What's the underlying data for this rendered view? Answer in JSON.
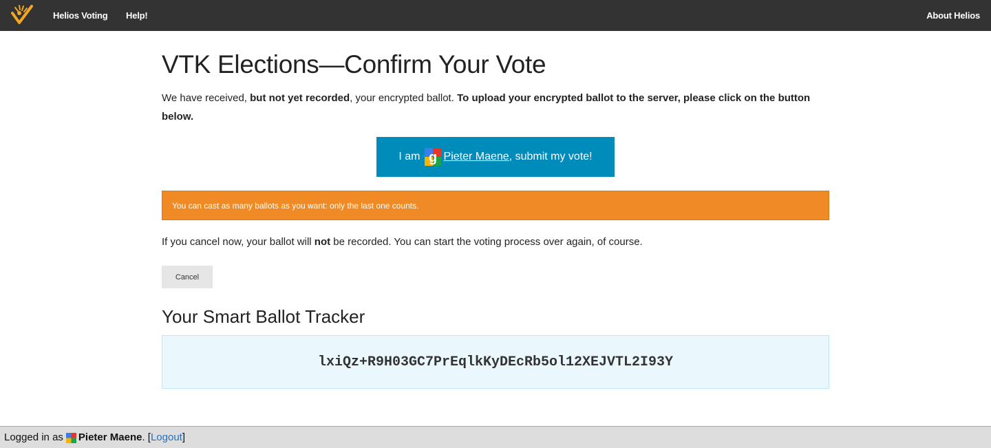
{
  "nav": {
    "brand": "Helios Voting",
    "help": "Help!",
    "about": "About Helios"
  },
  "page": {
    "title": "VTK Elections—Confirm Your Vote",
    "intro_1": "We have received, ",
    "intro_bold_1": "but not yet recorded",
    "intro_2": ", your encrypted ballot. ",
    "intro_bold_2": "To upload your encrypted ballot to the server, please click on the button below."
  },
  "submit": {
    "prefix": "I am",
    "user": " Pieter Maene",
    "suffix": ", submit my vote!"
  },
  "alert": {
    "text": "You can cast as many ballots as you want: only the last one counts."
  },
  "cancel": {
    "note_1": "If you cancel now, your ballot will ",
    "note_bold": "not",
    "note_2": " be recorded. You can start the voting process over again, of course.",
    "button": "Cancel"
  },
  "tracker": {
    "title": "Your Smart Ballot Tracker",
    "hash": "lxiQz+R9H03GC7PrEqlkKyDEcRb5ol12XEJVTL2I93Y"
  },
  "footer": {
    "logged_in_as": "Logged in as",
    "user": "Pieter Maene",
    "period": ". [",
    "logout": "Logout",
    "close": "]"
  },
  "colors": {
    "topbar": "#333333",
    "submit_button": "#008cba",
    "alert": "#f08a24",
    "tracker_bg": "#eaf8fe",
    "footer_bg": "#dddddd",
    "link": "#2a6fb8"
  },
  "icons": {
    "logo": "helios-checkmark-logo-icon",
    "provider": "google-icon"
  }
}
